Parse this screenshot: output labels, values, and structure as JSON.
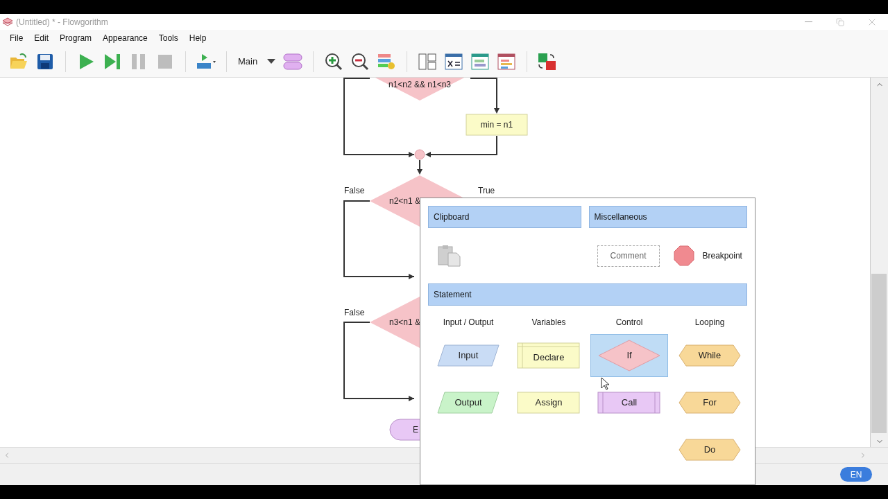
{
  "window": {
    "title": "(Untitled) * - Flowgorithm"
  },
  "menu": [
    "File",
    "Edit",
    "Program",
    "Appearance",
    "Tools",
    "Help"
  ],
  "toolbar": {
    "function_select": "Main"
  },
  "flowchart": {
    "nodes": [
      {
        "kind": "decision",
        "text": "n1<n2 && n1<n3"
      },
      {
        "kind": "assign",
        "text": "min = n1"
      },
      {
        "kind": "decision",
        "text": "n2<n1 &"
      },
      {
        "kind": "decision",
        "text": "n3<n1 &"
      },
      {
        "kind": "terminal",
        "text": "E"
      }
    ],
    "labels": [
      "False",
      "True",
      "False"
    ]
  },
  "palette": {
    "clipboard": {
      "title": "Clipboard"
    },
    "miscellaneous": {
      "title": "Miscellaneous",
      "comment": "Comment",
      "breakpoint": "Breakpoint"
    },
    "statement": {
      "title": "Statement",
      "columns": [
        {
          "heading": "Input / Output",
          "items": [
            {
              "kind": "input",
              "label": "Input",
              "selected": false
            },
            {
              "kind": "output",
              "label": "Output",
              "selected": false
            }
          ]
        },
        {
          "heading": "Variables",
          "items": [
            {
              "kind": "declare",
              "label": "Declare",
              "selected": false
            },
            {
              "kind": "assign",
              "label": "Assign",
              "selected": false
            }
          ]
        },
        {
          "heading": "Control",
          "items": [
            {
              "kind": "if",
              "label": "If",
              "selected": true
            },
            {
              "kind": "call",
              "label": "Call",
              "selected": false
            }
          ]
        },
        {
          "heading": "Looping",
          "items": [
            {
              "kind": "loop",
              "label": "While",
              "selected": false
            },
            {
              "kind": "loop",
              "label": "For",
              "selected": false
            },
            {
              "kind": "loop",
              "label": "Do",
              "selected": false
            }
          ]
        }
      ]
    }
  },
  "status_bar": {
    "language": "EN"
  }
}
